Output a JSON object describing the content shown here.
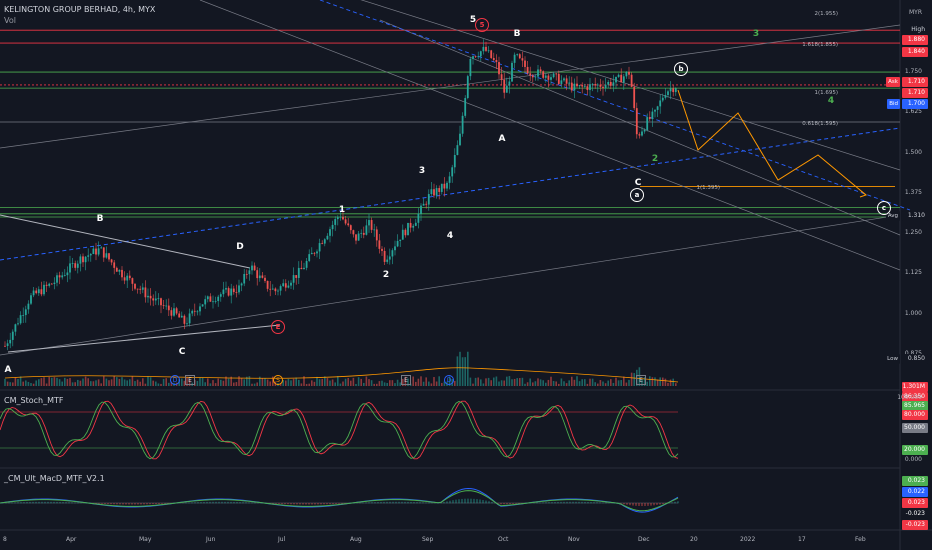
{
  "header": {
    "title": "KELINGTON GROUP BERHAD, 4h, MYX",
    "volume_label": "Vol"
  },
  "price_scale": {
    "currency": "MYR",
    "labels": [
      "1.880",
      "1.750",
      "1.625",
      "1.500",
      "1.375",
      "1.250",
      "1.125",
      "1.000",
      "0.875"
    ]
  },
  "price_tags": [
    {
      "name": "high-label",
      "text": "High",
      "value_text": "1.880",
      "color": "#131722",
      "text_color": "#d1d4dc"
    },
    {
      "name": "fib-1880-tag",
      "text": "1.880",
      "color": "#f23645",
      "text_color": "#ffffff"
    },
    {
      "name": "fib-1840-tag",
      "text": "1.840",
      "color": "#f23645",
      "text_color": "#ffffff"
    },
    {
      "name": "ask-tag",
      "text": "1.710",
      "label": "Ask",
      "color": "#f23645",
      "text_color": "#ffffff"
    },
    {
      "name": "last-price-tag",
      "text": "1.710",
      "color": "#f23645",
      "text_color": "#ffffff"
    },
    {
      "name": "bid-tag",
      "text": "1.700",
      "label": "Bid",
      "color": "#2962ff",
      "text_color": "#ffffff"
    },
    {
      "name": "avg-tag",
      "text": "1.310",
      "label": "Avg",
      "color": "#131722",
      "text_color": "#d1d4dc"
    },
    {
      "name": "low-label",
      "text": "0.850",
      "label": "Low",
      "color": "#131722",
      "text_color": "#d1d4dc"
    },
    {
      "name": "volume-tag",
      "text": "1.301M",
      "color": "#f23645",
      "text_color": "#ffffff"
    }
  ],
  "fib_labels": [
    {
      "name": "fib-2",
      "text": "2(1.955)"
    },
    {
      "name": "fib-1618",
      "text": "1.618(1.855)"
    },
    {
      "name": "fib-1",
      "text": "1(1.695)"
    },
    {
      "name": "fib-0618",
      "text": "0.618(1.595)"
    },
    {
      "name": "fib-target",
      "text": "1(1.395)"
    }
  ],
  "wave_labels": [
    {
      "text": "A",
      "color": "#ffffff"
    },
    {
      "text": "B",
      "color": "#ffffff"
    },
    {
      "text": "C",
      "color": "#ffffff"
    },
    {
      "text": "D",
      "color": "#ffffff"
    },
    {
      "text": "E",
      "color": "#f23645"
    },
    {
      "text": "1",
      "color": "#ffffff"
    },
    {
      "text": "2",
      "color": "#ffffff"
    },
    {
      "text": "3",
      "color": "#ffffff"
    },
    {
      "text": "4",
      "color": "#ffffff"
    },
    {
      "text": "5",
      "color": "#ffffff"
    },
    {
      "text": "5",
      "color": "#f23645"
    },
    {
      "text": "A",
      "color": "#ffffff"
    },
    {
      "text": "B",
      "color": "#ffffff"
    },
    {
      "text": "C",
      "color": "#ffffff"
    },
    {
      "text": "a",
      "color": "#ffffff"
    },
    {
      "text": "b",
      "color": "#ffffff"
    },
    {
      "text": "c",
      "color": "#ffffff"
    },
    {
      "text": "2",
      "color": "#4caf50"
    },
    {
      "text": "3",
      "color": "#4caf50"
    },
    {
      "text": "4",
      "color": "#4caf50"
    }
  ],
  "event_markers": [
    {
      "text": "D",
      "color": "#2962ff"
    },
    {
      "text": "E",
      "color": "#787b86"
    },
    {
      "text": "S",
      "color": "#ff9800"
    },
    {
      "text": "E",
      "color": "#787b86"
    },
    {
      "text": "D",
      "color": "#2962ff"
    },
    {
      "text": "E",
      "color": "#787b86"
    }
  ],
  "stoch": {
    "title": "CM_Stoch_MTF",
    "scale": [
      "100.000",
      "0.000"
    ],
    "tags": [
      {
        "text": "86.350",
        "color": "#f23645"
      },
      {
        "text": "85.965",
        "color": "#4caf50"
      },
      {
        "text": "80.000",
        "color": "#f23645"
      },
      {
        "text": "50.000",
        "color": "#787b86"
      },
      {
        "text": "20.000",
        "color": "#4caf50"
      }
    ]
  },
  "macd": {
    "title": "_CM_Ult_MacD_MTF_V2.1",
    "tags": [
      {
        "text": "0.023",
        "color": "#4caf50"
      },
      {
        "text": "0.022",
        "color": "#2962ff"
      },
      {
        "text": "0.023",
        "color": "#f23645"
      },
      {
        "text": "-0.023",
        "color": "#131722"
      },
      {
        "text": "-0.023",
        "color": "#f23645"
      }
    ]
  },
  "time_axis": [
    "8",
    "Apr",
    "May",
    "Jun",
    "Jul",
    "Aug",
    "Sep",
    "Oct",
    "Nov",
    "Dec",
    "20",
    "2022",
    "17",
    "Feb"
  ],
  "chart_data": {
    "type": "line",
    "title": "KELINGTON GROUP BERHAD, 4h, MYX",
    "xlabel": "",
    "ylabel": "",
    "ylim": [
      0.85,
      1.95
    ],
    "grid": false,
    "series": [
      {
        "name": "",
        "x": [
          "8",
          "Apr",
          "May",
          "Jun",
          "Jul",
          "Aug",
          "Sep",
          "Oct",
          "Nov",
          "Dec"
        ],
        "values": [
          0.88,
          1.17,
          0.99,
          1.06,
          1.1,
          1.3,
          1.34,
          1.8,
          1.71,
          1.7
        ]
      }
    ]
  }
}
